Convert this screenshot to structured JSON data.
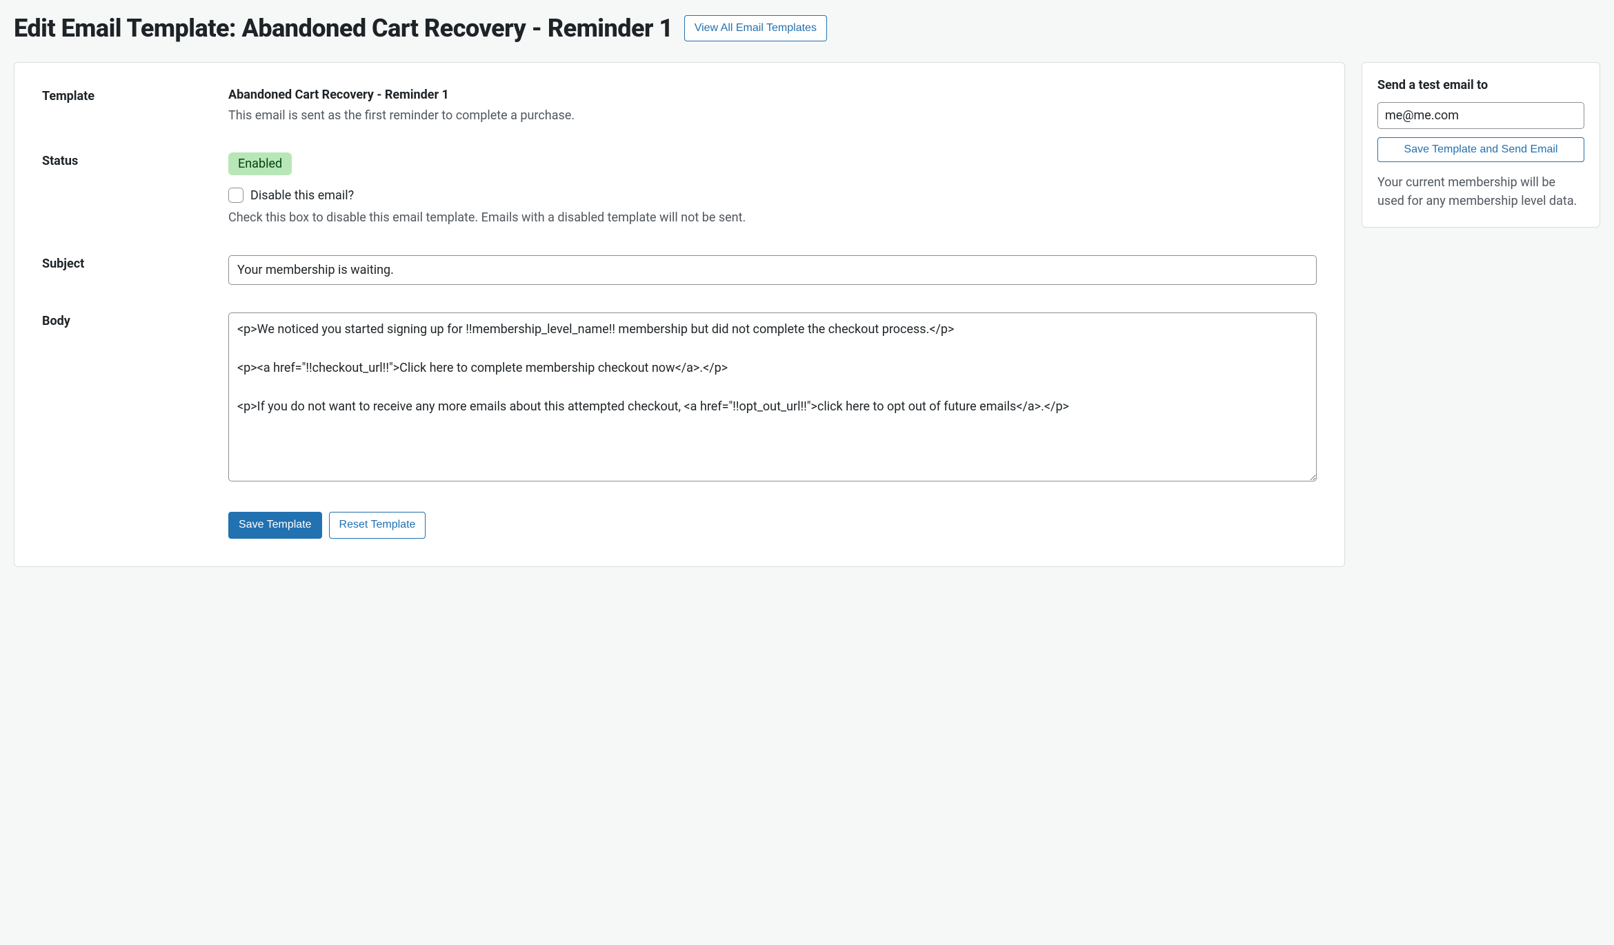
{
  "header": {
    "title": "Edit Email Template: Abandoned Cart Recovery - Reminder 1",
    "view_all_label": "View All Email Templates"
  },
  "form": {
    "template_label": "Template",
    "template_name": "Abandoned Cart Recovery - Reminder 1",
    "template_desc": "This email is sent as the first reminder to complete a purchase.",
    "status_label": "Status",
    "status_badge": "Enabled",
    "disable_checkbox_label": "Disable this email?",
    "disable_help": "Check this box to disable this email template. Emails with a disabled template will not be sent.",
    "subject_label": "Subject",
    "subject_value": "Your membership is waiting.",
    "body_label": "Body",
    "body_value": "<p>We noticed you started signing up for !!membership_level_name!! membership but did not complete the checkout process.</p>\n\n<p><a href=\"!!checkout_url!!\">Click here to complete membership checkout now</a>.</p>\n\n<p>If you do not want to receive any more emails about this attempted checkout, <a href=\"!!opt_out_url!!\">click here to opt out of future emails</a>.</p>",
    "save_label": "Save Template",
    "reset_label": "Reset Template"
  },
  "sidebar": {
    "heading": "Send a test email to",
    "email_value": "me@me.com",
    "send_label": "Save Template and Send Email",
    "note": "Your current membership will be used for any membership level data."
  }
}
